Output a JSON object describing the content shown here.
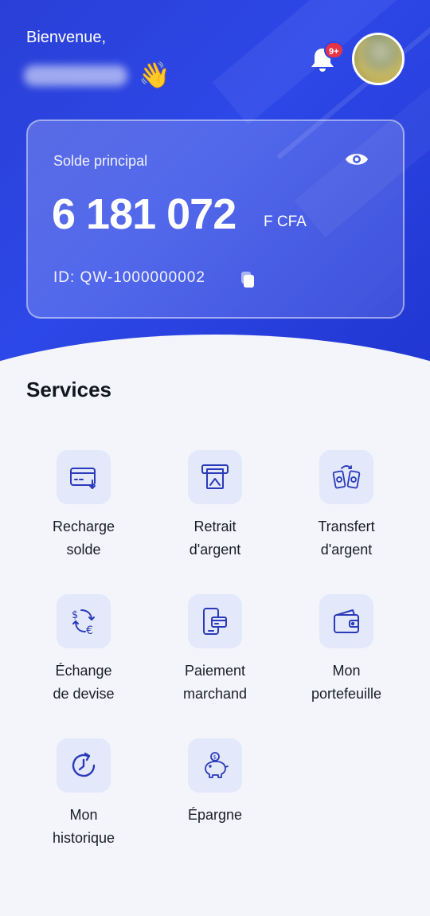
{
  "header": {
    "greeting": "Bienvenue,",
    "wave_emoji": "👋",
    "notification_badge": "9+",
    "icons": {
      "bell": "bell-icon",
      "avatar": "avatar"
    }
  },
  "balance_card": {
    "label": "Solde principal",
    "amount": "6 181 072",
    "currency": "F CFA",
    "account_id": "ID: QW-1000000002",
    "icons": {
      "visibility": "eye-icon",
      "copy": "copy-icon"
    }
  },
  "services": {
    "title": "Services",
    "items": [
      {
        "line1": "Recharge",
        "line2": "solde",
        "icon": "card-download-icon"
      },
      {
        "line1": "Retrait",
        "line2": "d'argent",
        "icon": "atm-withdraw-icon"
      },
      {
        "line1": "Transfert",
        "line2": "d'argent",
        "icon": "phones-transfer-icon"
      },
      {
        "line1": "Échange",
        "line2": "de devise",
        "icon": "currency-exchange-icon"
      },
      {
        "line1": "Paiement",
        "line2": "marchand",
        "icon": "merchant-payment-icon"
      },
      {
        "line1": "Mon",
        "line2": "portefeuille",
        "icon": "wallet-icon"
      },
      {
        "line1": "Mon",
        "line2": "historique",
        "icon": "history-icon"
      },
      {
        "line1": "Épargne",
        "line2": "",
        "icon": "piggy-bank-icon"
      }
    ]
  },
  "colors": {
    "primary": "#2d48e8",
    "icon_stroke": "#2a3ab8",
    "icon_bg": "#e3e8fb",
    "badge": "#e53347",
    "background": "#f3f5fa"
  }
}
